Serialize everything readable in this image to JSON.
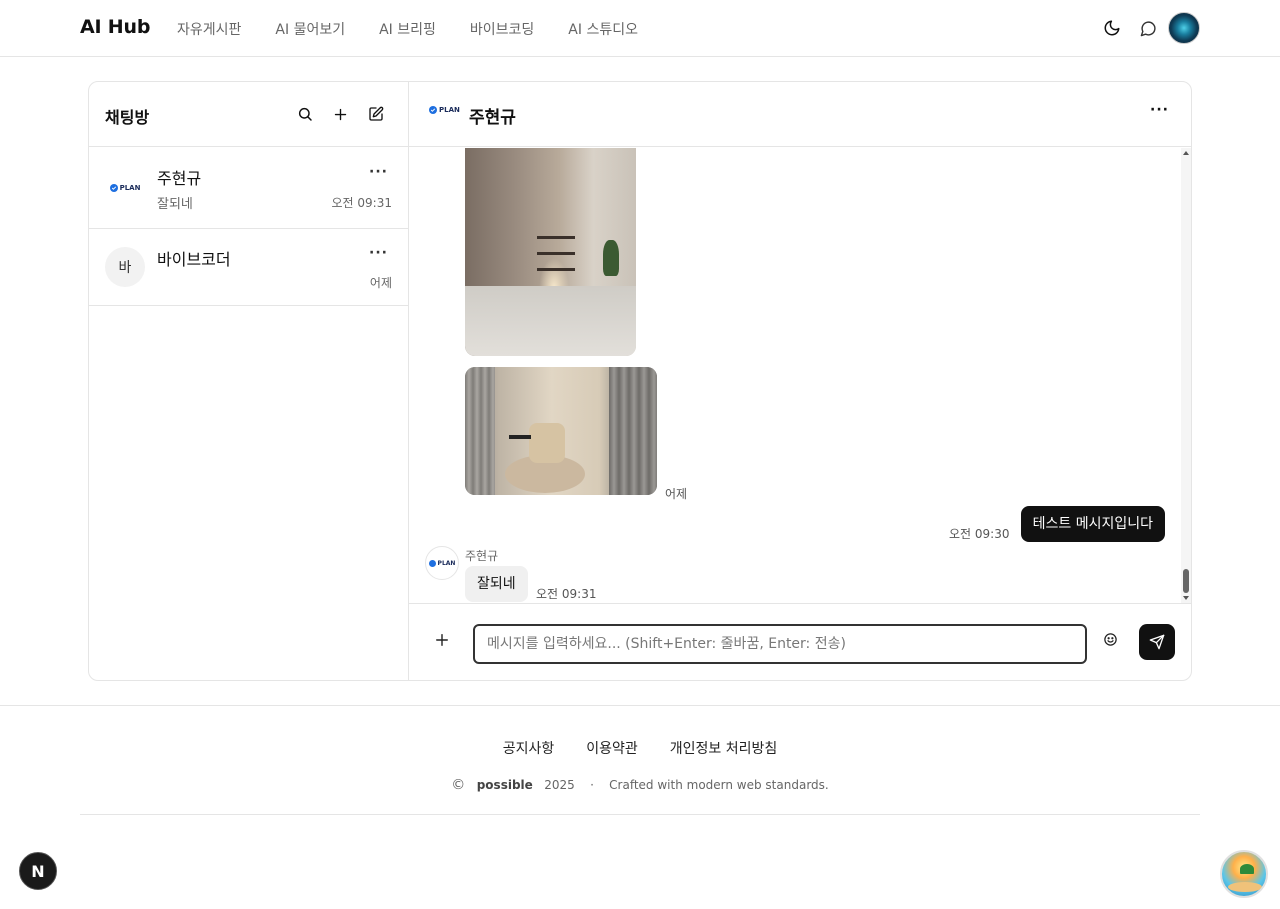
{
  "app": {
    "title": "AI Hub"
  },
  "nav": {
    "items": [
      {
        "label": "자유게시판"
      },
      {
        "label": "AI 물어보기"
      },
      {
        "label": "AI 브리핑"
      },
      {
        "label": "바이브코딩"
      },
      {
        "label": "AI 스튜디오"
      }
    ]
  },
  "header_icons": [
    "moon-icon",
    "chat-bubble-icon",
    "avatar"
  ],
  "sidebar": {
    "title": "채팅방",
    "actions": [
      "search-icon",
      "plus-icon",
      "edit-icon"
    ],
    "rooms": [
      {
        "name": "주현규",
        "last_message": "잘되네",
        "time": "오전 09:31",
        "avatar_text": "PLAN"
      },
      {
        "name": "바이브코더",
        "last_message": "",
        "time": "어제",
        "avatar_text": "바"
      }
    ]
  },
  "chat": {
    "title": "주현규",
    "avatar_text": "PLAN",
    "messages": [
      {
        "type": "image",
        "time": ""
      },
      {
        "type": "image",
        "time": "어제"
      },
      {
        "type": "text",
        "from": "me",
        "text": "테스트 메시지입니다",
        "time": "오전 09:30"
      },
      {
        "type": "text",
        "from": "주현규",
        "text": "잘되네",
        "time": "오전 09:31"
      }
    ],
    "composer": {
      "placeholder": "메시지를 입력하세요... (Shift+Enter: 줄바꿈, Enter: 전송)",
      "value": ""
    }
  },
  "footer": {
    "links": [
      "공지사항",
      "이용약관",
      "개인정보 처리방침"
    ],
    "copyright_symbol": "©",
    "brand": "possible",
    "year": "2025",
    "separator": "·",
    "tagline": "Crafted with modern web standards."
  },
  "badges": {
    "next": "N"
  },
  "colors": {
    "primary": "#111111",
    "border": "#e5e5e5",
    "muted": "#666666",
    "plan_blue": "#1e6fe0"
  }
}
